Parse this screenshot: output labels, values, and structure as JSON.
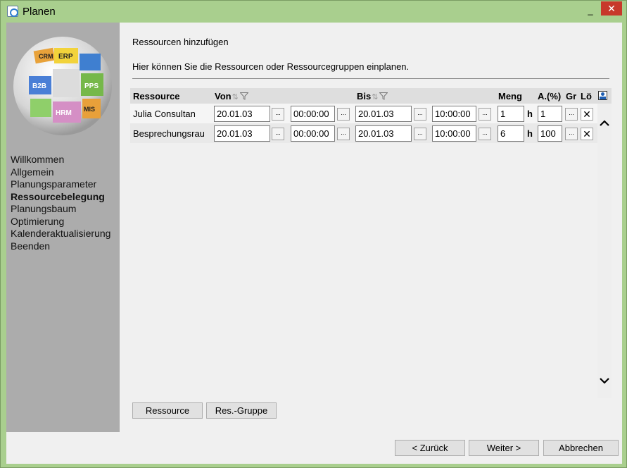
{
  "window": {
    "title": "Planen",
    "minimize": "_",
    "close": "✕"
  },
  "logo": {
    "labels": [
      "CRM",
      "ERP",
      "B2B",
      "PPS",
      "HRM",
      "MIS"
    ]
  },
  "sidebar": {
    "items": [
      {
        "label": "Willkommen",
        "active": false
      },
      {
        "label": "Allgemein",
        "active": false
      },
      {
        "label": "Planungsparameter",
        "active": false
      },
      {
        "label": "Ressourcebelegung",
        "active": true
      },
      {
        "label": "Planungsbaum",
        "active": false
      },
      {
        "label": "Optimierung",
        "active": false
      },
      {
        "label": "Kalenderaktualisierung",
        "active": false
      },
      {
        "label": "Beenden",
        "active": false
      }
    ]
  },
  "main": {
    "title": "Ressourcen hinzufügen",
    "description": "Hier können Sie die Ressourcen oder Ressourcegruppen einplanen."
  },
  "grid": {
    "headers": {
      "resource": "Ressource",
      "from": "Von",
      "to": "Bis",
      "quantity": "Meng",
      "percent": "A.(%)",
      "group": "Gr",
      "delete": "Lö"
    },
    "ellipsis": "...",
    "unit": "h",
    "delete_glyph": "✕",
    "rows": [
      {
        "resource": "Julia Consultan",
        "from_date": "20.01.03",
        "from_time": "00:00:00",
        "to_date": "20.01.03",
        "to_time": "10:00:00",
        "quantity": "1",
        "percent": "1"
      },
      {
        "resource": "Besprechungsrau",
        "from_date": "20.01.03",
        "from_time": "00:00:00",
        "to_date": "20.01.03",
        "to_time": "10:00:00",
        "quantity": "6",
        "percent": "100"
      }
    ]
  },
  "actions": {
    "add_resource": "Ressource",
    "add_group": "Res.-Gruppe"
  },
  "footer": {
    "back": "< Zurück",
    "next": "Weiter >",
    "cancel": "Abbrechen"
  }
}
